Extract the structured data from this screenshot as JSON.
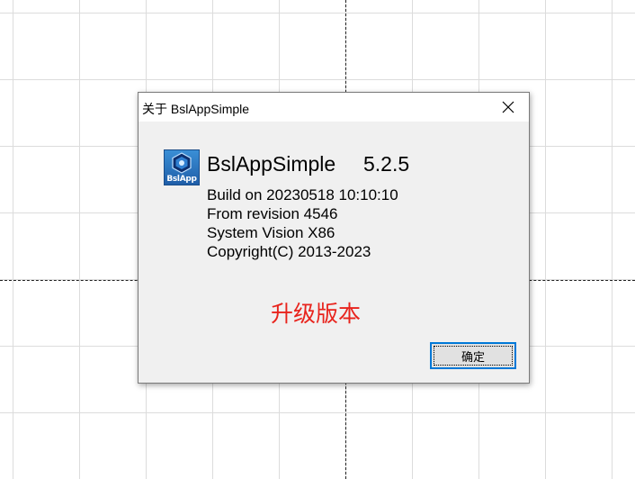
{
  "dialog": {
    "title": "关于 BslAppSimple",
    "app_icon_label": "BslApp",
    "app_name": "BslAppSimple",
    "app_version": "5.2.5",
    "info_lines": [
      "Build on 20230518 10:10:10",
      "From revision 4546",
      "System Vision X86",
      "Copyright(C) 2013-2023"
    ],
    "upgrade_label": "升级版本",
    "ok_label": "确定"
  },
  "icons": {
    "close": "close-icon",
    "app": "bslapp-logo-icon"
  },
  "colors": {
    "upgrade_text": "#e8231c",
    "focus_border": "#0078d7",
    "dialog_bg": "#f0f0f0"
  }
}
